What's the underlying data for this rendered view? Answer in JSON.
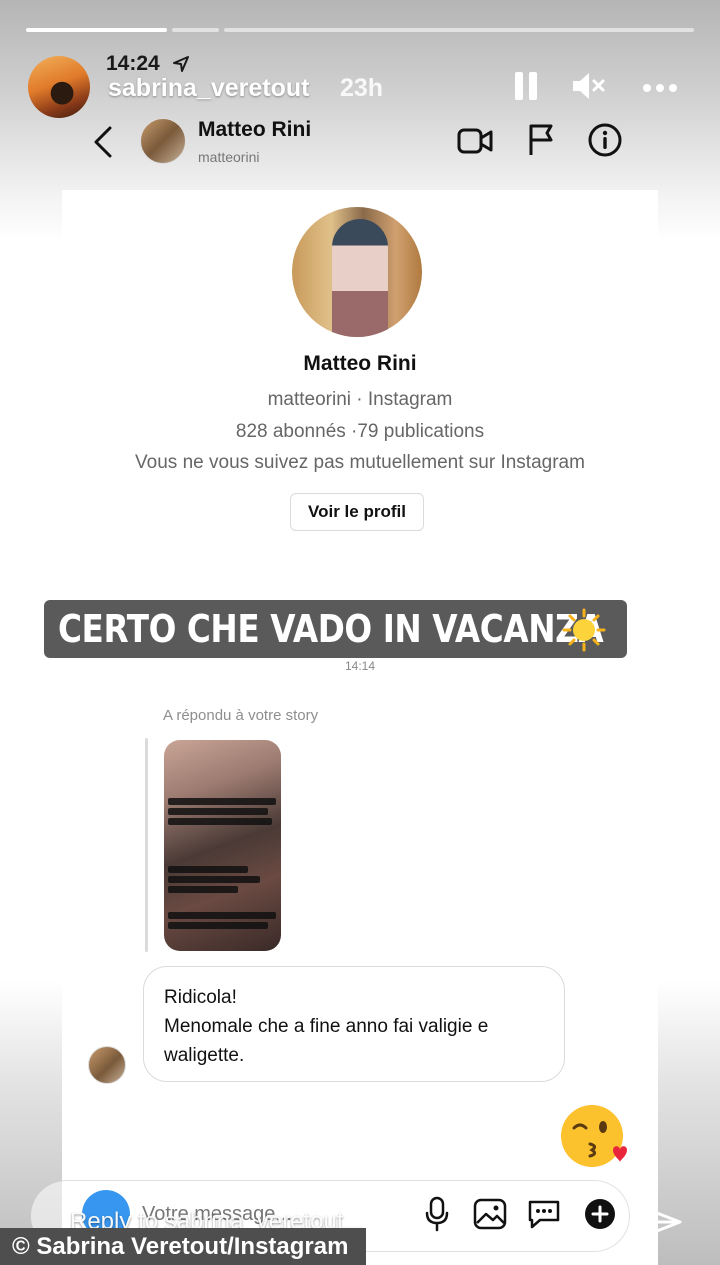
{
  "story": {
    "time": "14:24",
    "username": "sabrina_veretout",
    "age": "23h",
    "reply_placeholder": "Reply to sabrina_veretout..."
  },
  "dm_header": {
    "name": "Matteo Rini",
    "handle": "matteorini",
    "icons": [
      "back-icon",
      "video-call-icon",
      "flag-icon",
      "info-icon"
    ]
  },
  "profile": {
    "name": "Matteo Rini",
    "subtitle": "matteorini · Instagram",
    "stats": "828 abonnés ·79 publications",
    "mutual": "Vous ne vous suivez pas mutuellement sur Instagram",
    "view_profile_label": "Voir le profil"
  },
  "caption": {
    "text": "CERTO CHE VADO IN VACANZA"
  },
  "thread": {
    "timestamp": "14:14",
    "reply_label": "A répondu à votre story",
    "message_lines": [
      "Ridicola!",
      "Menomale che a fine anno fai valigie e",
      "waligette."
    ],
    "reaction_emoji": "kiss-wink-emoji"
  },
  "composer": {
    "placeholder": "Votre message..."
  },
  "credit": "© Sabrina Veretout/Instagram",
  "colors": {
    "accent_blue": "#3797f0",
    "caption_bg": "#5a5a5a",
    "text_secondary": "#8e8e8e"
  }
}
